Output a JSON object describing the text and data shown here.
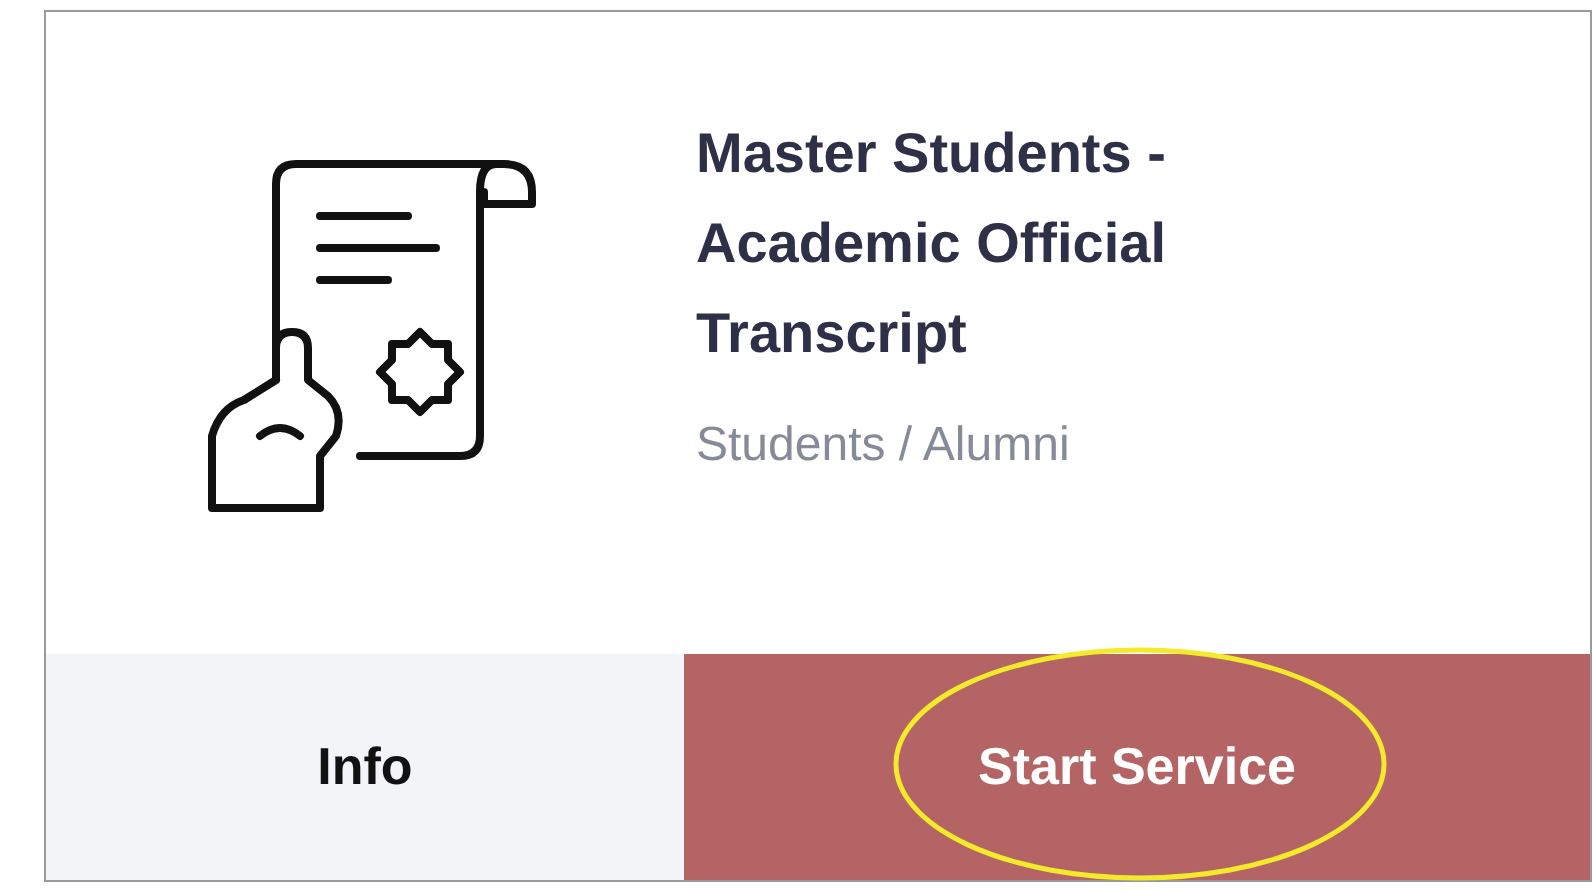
{
  "service": {
    "title": "Master Students - Academic Official Transcript",
    "category": "Students / Alumni"
  },
  "actions": [
    {
      "label": "Info",
      "kind": "secondary",
      "highlighted": false
    },
    {
      "label": "Start Service",
      "kind": "primary",
      "highlighted": true
    }
  ]
}
